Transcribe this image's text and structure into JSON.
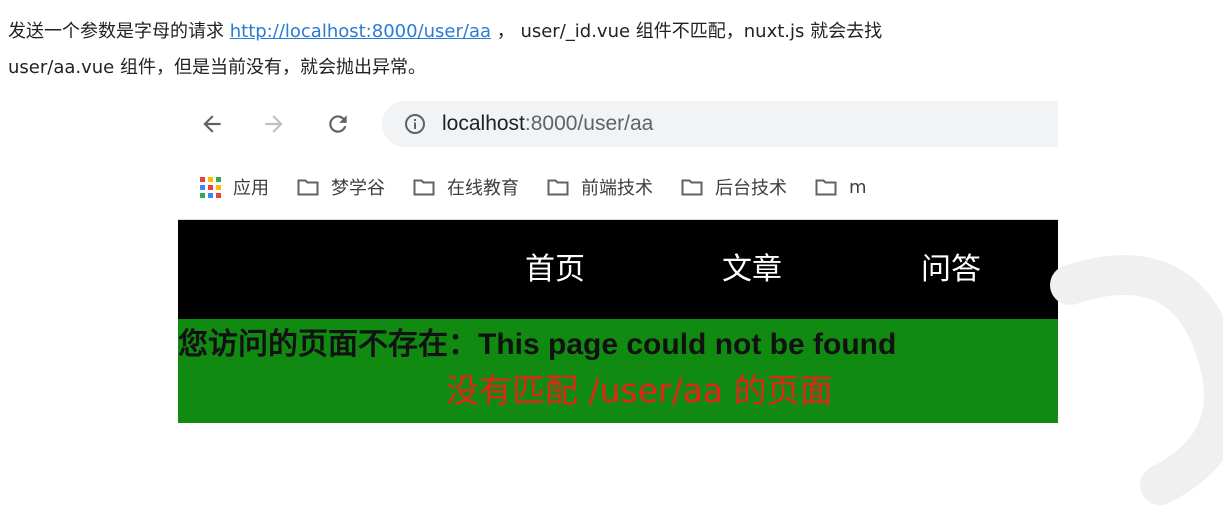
{
  "article": {
    "line1_prefix": "发送一个参数是字母的请求 ",
    "line1_link": "http://localhost:8000/user/aa",
    "line1_suffix": " ， user/_id.vue 组件不匹配，nuxt.js 就会去找",
    "line2": "user/aa.vue 组件，但是当前没有，就会抛出异常。"
  },
  "browser": {
    "url_host": "localhost",
    "url_path": ":8000/user/aa",
    "icons": {
      "back": "back-arrow-icon",
      "forward": "forward-arrow-icon",
      "reload": "reload-icon",
      "info": "info-icon",
      "apps": "apps-grid-icon",
      "folder": "folder-icon"
    },
    "bookmarks": [
      "应用",
      "梦学谷",
      "在线教育",
      "前端技术",
      "后台技术",
      "m"
    ]
  },
  "page": {
    "nav": [
      "首页",
      "文章",
      "问答"
    ],
    "error_title": "您访问的页面不存在：This page could not be found",
    "error_message": "没有匹配 /user/aa 的页面"
  },
  "colors": {
    "link": "#2b7bd6",
    "nav_background": "#000000",
    "error_background": "#118a11",
    "error_message": "#e3231c"
  }
}
